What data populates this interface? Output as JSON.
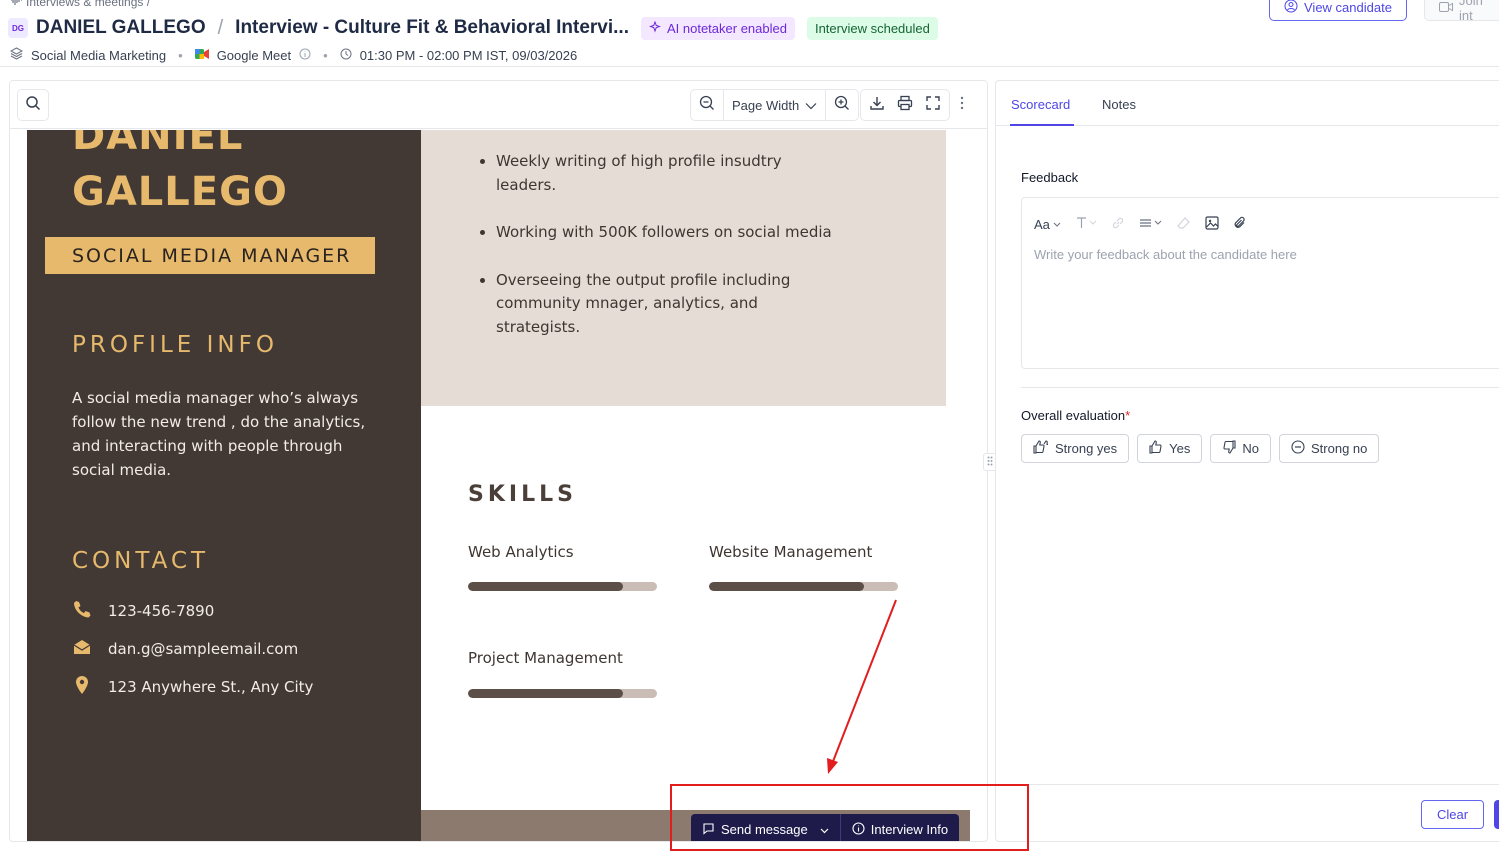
{
  "breadcrumb": {
    "text": "Interviews & meetings /"
  },
  "header": {
    "avatar_initials": "DG",
    "candidate_name": "DANIEL GALLEGO",
    "separator": "/",
    "interview_title": "Interview - Culture Fit & Behavioral Intervi...",
    "badge_ai": "AI notetaker enabled",
    "badge_status": "Interview scheduled",
    "meta": {
      "job": "Social Media Marketing",
      "platform": "Google Meet",
      "time": "01:30 PM - 02:00 PM IST, 09/03/2026"
    },
    "view_candidate": "View candidate",
    "join": "Join int"
  },
  "viewer": {
    "zoom_mode": "Page Width"
  },
  "resume": {
    "name_line1": "DANIEL",
    "name_line2": "GALLEGO",
    "role": "SOCIAL MEDIA MANAGER",
    "profile_heading": "PROFILE INFO",
    "profile_text": "A social media manager who’s always follow the new trend , do the analytics, and interacting with people through social media.",
    "contact_heading": "CONTACT",
    "phone": "123-456-7890",
    "email": "dan.g@sampleemail.com",
    "address": "123 Anywhere St., Any City",
    "bullets": [
      "Weekly writing of high profile insudtry leaders.",
      "Working with 500K followers on social media",
      "Overseeing the output profile including community mnager, analytics, and strategists."
    ],
    "skills_heading": "SKILLS",
    "skills": [
      {
        "name": "Web Analytics",
        "level": 0.82
      },
      {
        "name": "Website Management",
        "level": 0.82
      },
      {
        "name": "Project Management",
        "level": 0.82
      }
    ]
  },
  "float_bar": {
    "send_message": "Send message",
    "interview_info": "Interview Info"
  },
  "panel": {
    "tabs": [
      "Scorecard",
      "Notes"
    ],
    "feedback_label": "Feedback",
    "font_tool": "Aa",
    "feedback_placeholder": "Write your feedback about the candidate here",
    "overall_label": "Overall evaluation",
    "required_mark": "*",
    "eval_options": [
      "Strong yes",
      "Yes",
      "No",
      "Strong no"
    ],
    "clear": "Clear"
  },
  "colors": {
    "accent": "#4f46e5",
    "resume_dark": "#423834",
    "resume_gold": "#e6b96c",
    "resume_light": "#e4dcd5"
  }
}
